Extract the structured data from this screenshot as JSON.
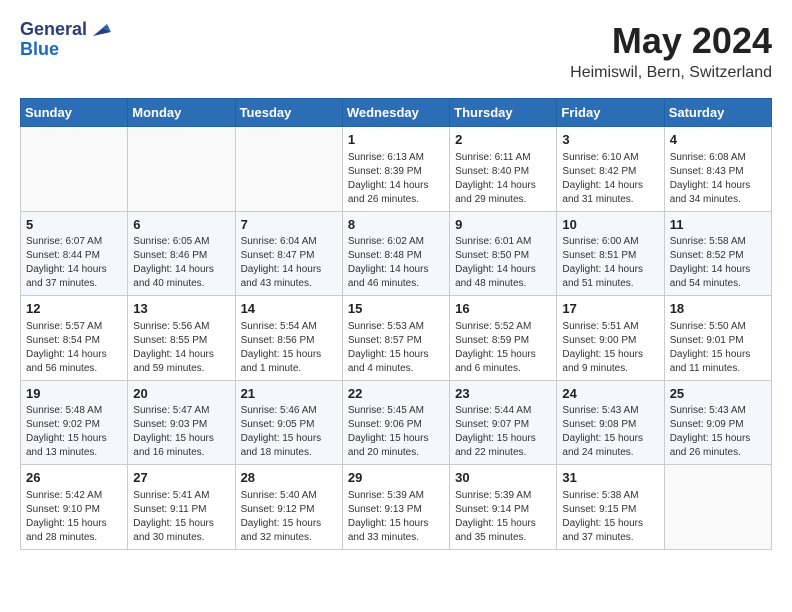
{
  "header": {
    "logo_line1": "General",
    "logo_line2": "Blue",
    "month": "May 2024",
    "location": "Heimiswil, Bern, Switzerland"
  },
  "weekdays": [
    "Sunday",
    "Monday",
    "Tuesday",
    "Wednesday",
    "Thursday",
    "Friday",
    "Saturday"
  ],
  "weeks": [
    [
      {
        "day": "",
        "info": ""
      },
      {
        "day": "",
        "info": ""
      },
      {
        "day": "",
        "info": ""
      },
      {
        "day": "1",
        "info": "Sunrise: 6:13 AM\nSunset: 8:39 PM\nDaylight: 14 hours\nand 26 minutes."
      },
      {
        "day": "2",
        "info": "Sunrise: 6:11 AM\nSunset: 8:40 PM\nDaylight: 14 hours\nand 29 minutes."
      },
      {
        "day": "3",
        "info": "Sunrise: 6:10 AM\nSunset: 8:42 PM\nDaylight: 14 hours\nand 31 minutes."
      },
      {
        "day": "4",
        "info": "Sunrise: 6:08 AM\nSunset: 8:43 PM\nDaylight: 14 hours\nand 34 minutes."
      }
    ],
    [
      {
        "day": "5",
        "info": "Sunrise: 6:07 AM\nSunset: 8:44 PM\nDaylight: 14 hours\nand 37 minutes."
      },
      {
        "day": "6",
        "info": "Sunrise: 6:05 AM\nSunset: 8:46 PM\nDaylight: 14 hours\nand 40 minutes."
      },
      {
        "day": "7",
        "info": "Sunrise: 6:04 AM\nSunset: 8:47 PM\nDaylight: 14 hours\nand 43 minutes."
      },
      {
        "day": "8",
        "info": "Sunrise: 6:02 AM\nSunset: 8:48 PM\nDaylight: 14 hours\nand 46 minutes."
      },
      {
        "day": "9",
        "info": "Sunrise: 6:01 AM\nSunset: 8:50 PM\nDaylight: 14 hours\nand 48 minutes."
      },
      {
        "day": "10",
        "info": "Sunrise: 6:00 AM\nSunset: 8:51 PM\nDaylight: 14 hours\nand 51 minutes."
      },
      {
        "day": "11",
        "info": "Sunrise: 5:58 AM\nSunset: 8:52 PM\nDaylight: 14 hours\nand 54 minutes."
      }
    ],
    [
      {
        "day": "12",
        "info": "Sunrise: 5:57 AM\nSunset: 8:54 PM\nDaylight: 14 hours\nand 56 minutes."
      },
      {
        "day": "13",
        "info": "Sunrise: 5:56 AM\nSunset: 8:55 PM\nDaylight: 14 hours\nand 59 minutes."
      },
      {
        "day": "14",
        "info": "Sunrise: 5:54 AM\nSunset: 8:56 PM\nDaylight: 15 hours\nand 1 minute."
      },
      {
        "day": "15",
        "info": "Sunrise: 5:53 AM\nSunset: 8:57 PM\nDaylight: 15 hours\nand 4 minutes."
      },
      {
        "day": "16",
        "info": "Sunrise: 5:52 AM\nSunset: 8:59 PM\nDaylight: 15 hours\nand 6 minutes."
      },
      {
        "day": "17",
        "info": "Sunrise: 5:51 AM\nSunset: 9:00 PM\nDaylight: 15 hours\nand 9 minutes."
      },
      {
        "day": "18",
        "info": "Sunrise: 5:50 AM\nSunset: 9:01 PM\nDaylight: 15 hours\nand 11 minutes."
      }
    ],
    [
      {
        "day": "19",
        "info": "Sunrise: 5:48 AM\nSunset: 9:02 PM\nDaylight: 15 hours\nand 13 minutes."
      },
      {
        "day": "20",
        "info": "Sunrise: 5:47 AM\nSunset: 9:03 PM\nDaylight: 15 hours\nand 16 minutes."
      },
      {
        "day": "21",
        "info": "Sunrise: 5:46 AM\nSunset: 9:05 PM\nDaylight: 15 hours\nand 18 minutes."
      },
      {
        "day": "22",
        "info": "Sunrise: 5:45 AM\nSunset: 9:06 PM\nDaylight: 15 hours\nand 20 minutes."
      },
      {
        "day": "23",
        "info": "Sunrise: 5:44 AM\nSunset: 9:07 PM\nDaylight: 15 hours\nand 22 minutes."
      },
      {
        "day": "24",
        "info": "Sunrise: 5:43 AM\nSunset: 9:08 PM\nDaylight: 15 hours\nand 24 minutes."
      },
      {
        "day": "25",
        "info": "Sunrise: 5:43 AM\nSunset: 9:09 PM\nDaylight: 15 hours\nand 26 minutes."
      }
    ],
    [
      {
        "day": "26",
        "info": "Sunrise: 5:42 AM\nSunset: 9:10 PM\nDaylight: 15 hours\nand 28 minutes."
      },
      {
        "day": "27",
        "info": "Sunrise: 5:41 AM\nSunset: 9:11 PM\nDaylight: 15 hours\nand 30 minutes."
      },
      {
        "day": "28",
        "info": "Sunrise: 5:40 AM\nSunset: 9:12 PM\nDaylight: 15 hours\nand 32 minutes."
      },
      {
        "day": "29",
        "info": "Sunrise: 5:39 AM\nSunset: 9:13 PM\nDaylight: 15 hours\nand 33 minutes."
      },
      {
        "day": "30",
        "info": "Sunrise: 5:39 AM\nSunset: 9:14 PM\nDaylight: 15 hours\nand 35 minutes."
      },
      {
        "day": "31",
        "info": "Sunrise: 5:38 AM\nSunset: 9:15 PM\nDaylight: 15 hours\nand 37 minutes."
      },
      {
        "day": "",
        "info": ""
      }
    ]
  ]
}
